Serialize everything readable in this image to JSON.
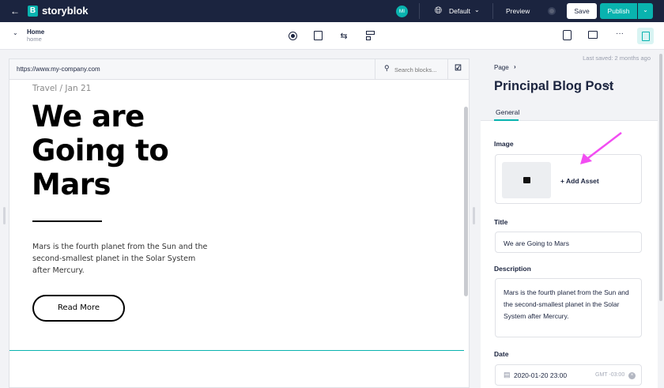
{
  "topbar": {
    "brand": "storyblok",
    "avatar": "MI",
    "language": "Default",
    "preview": "Preview",
    "save": "Save",
    "publish": "Publish"
  },
  "toolbar": {
    "story_name": "Home",
    "story_slug": "home"
  },
  "preview": {
    "url": "https://www.my-company.com",
    "search_placeholder": "Search blocks...",
    "meta": "Travel / Jan 21",
    "heading_lines": [
      "We are",
      "Going to",
      "Mars"
    ],
    "paragraph": "Mars is the fourth planet from the Sun and the second-smallest planet in the Solar System after Mercury.",
    "button": "Read More"
  },
  "panel": {
    "last_saved": "Last saved: 2 months ago",
    "breadcrumb": "Page",
    "title": "Principal Blog Post",
    "tab": "General",
    "image_label": "Image",
    "add_asset": "+ Add Asset",
    "title_label": "Title",
    "title_value": "We are Going to Mars",
    "description_label": "Description",
    "description_value": "Mars is the fourth planet from the Sun and the second-smallest planet in the Solar System after Mercury.",
    "date_label": "Date",
    "date_value": "2020-01-20 23:00",
    "timezone": "GMT -03:00"
  },
  "colors": {
    "navy": "#1b243f",
    "teal": "#09b3af",
    "arrow": "#f24df2"
  }
}
